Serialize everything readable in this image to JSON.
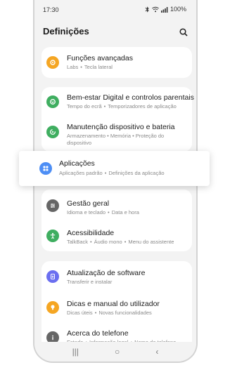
{
  "status": {
    "time": "17:30",
    "battery": "100%"
  },
  "header": {
    "title": "Definições"
  },
  "colors": {
    "orange": "#f5a623",
    "green": "#3fae60",
    "blue": "#4d8ef5",
    "purple": "#6b6ff0",
    "gray": "#666666"
  },
  "groups": [
    {
      "items": [
        {
          "title": "Funções avançadas",
          "subs": [
            "Labs",
            "Tecla lateral"
          ],
          "icon": "gear-plus-icon"
        }
      ]
    },
    {
      "items": [
        {
          "title": "Bem-estar Digital e controlos parentais",
          "subs": [
            "Tempo do ecrã",
            "Temporizadores de aplicação"
          ],
          "icon": "heart-icon"
        },
        {
          "title": "Manutenção dispositivo e bateria",
          "sub_text": "Armazenamento • Memória • Proteção do dispositivo",
          "icon": "care-icon"
        }
      ]
    },
    {
      "items": [
        {
          "title": "Gestão geral",
          "subs": [
            "Idioma e teclado",
            "Data e hora"
          ],
          "icon": "sliders-icon"
        },
        {
          "title": "Acessibilidade",
          "subs": [
            "TalkBack",
            "Áudio mono",
            "Menu do assistente"
          ],
          "icon": "accessibility-icon"
        }
      ]
    },
    {
      "items": [
        {
          "title": "Atualização de software",
          "subs": [
            "Transferir e instalar"
          ],
          "icon": "update-icon"
        },
        {
          "title": "Dicas e manual do utilizador",
          "subs": [
            "Dicas úteis",
            "Novas funcionalidades"
          ],
          "icon": "bulb-icon"
        },
        {
          "title": "Acerca do telefone",
          "subs": [
            "Estado",
            "Informação legal",
            "Nome do telefone"
          ],
          "icon": "info-icon"
        }
      ]
    }
  ],
  "highlight": {
    "title": "Aplicações",
    "subs": [
      "Aplicações padrão",
      "Definições da aplicação"
    ],
    "icon": "apps-icon"
  },
  "navbar": {
    "recent": "|||",
    "home": "○",
    "back": "‹"
  }
}
